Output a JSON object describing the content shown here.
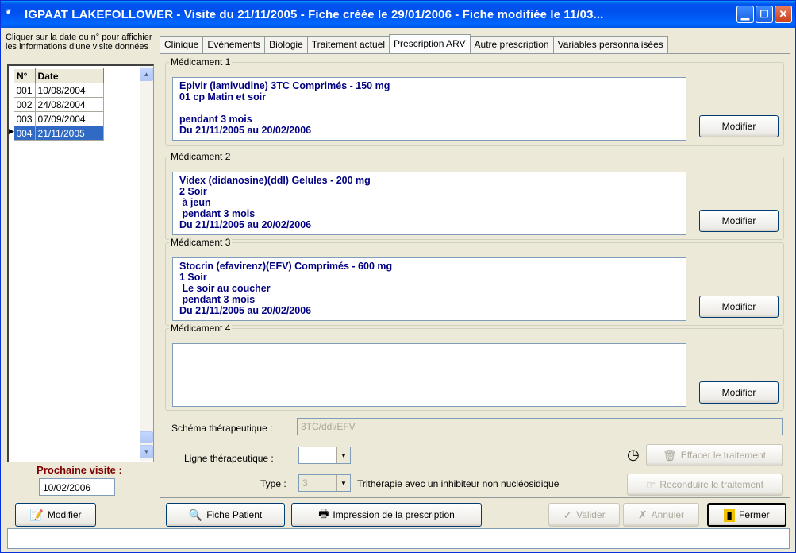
{
  "window": {
    "title": "IGPAAT LAKEFOLLOWER - Visite du 21/11/2005 - Fiche créée le 29/01/2006 - Fiche modifiée le 11/03...",
    "app_icon": "app-logo-icon",
    "controls": [
      "minimize",
      "maximize",
      "close"
    ]
  },
  "left": {
    "hint": "Cliquer sur la date ou n° pour affichier les informations d'une visite données",
    "columns": [
      "N°",
      "Date"
    ],
    "rows": [
      {
        "num": "001",
        "date": "10/08/2004"
      },
      {
        "num": "002",
        "date": "24/08/2004"
      },
      {
        "num": "003",
        "date": "07/09/2004"
      },
      {
        "num": "004",
        "date": "21/11/2005",
        "selected": true
      }
    ],
    "next_visit_label": "Prochaine visite :",
    "next_visit_value": "10/02/2006"
  },
  "tabs": [
    {
      "label": "Clinique"
    },
    {
      "label": "Evènements"
    },
    {
      "label": "Biologie"
    },
    {
      "label": "Traitement actuel"
    },
    {
      "label": "Prescription ARV",
      "active": true
    },
    {
      "label": "Autre prescription"
    },
    {
      "label": "Variables personnalisées"
    }
  ],
  "medications": [
    {
      "legend": "Médicament 1",
      "text": "Epivir (lamivudine) 3TC Comprimés - 150 mg\n01 cp Matin et soir\n\npendant 3 mois\nDu 21/11/2005 au 20/02/2006",
      "button": "Modifier"
    },
    {
      "legend": "Médicament 2",
      "text": "Videx (didanosine)(ddl) Gelules - 200 mg\n2 Soir\n à jeun\n pendant 3 mois\nDu 21/11/2005 au 20/02/2006",
      "button": "Modifier"
    },
    {
      "legend": "Médicament 3",
      "text": "Stocrin (efavirenz)(EFV) Comprimés - 600 mg\n1 Soir\n Le soir au coucher\n pendant 3 mois\nDu 21/11/2005 au 20/02/2006",
      "button": "Modifier"
    },
    {
      "legend": "Médicament 4",
      "text": "",
      "button": "Modifier"
    }
  ],
  "schema": {
    "label": "Schéma thérapeutique :",
    "value": "3TC/ddl/EFV"
  },
  "ligne": {
    "label": "Ligne thérapeutique :",
    "value": ""
  },
  "type": {
    "label": "Type :",
    "value": "3",
    "description": "Trithérapie avec un inhibiteur non nucléosidique"
  },
  "side_buttons": {
    "effacer": "Effacer le traitement",
    "reconduire": "Reconduire le traitement"
  },
  "bottom": {
    "modifier": "Modifier",
    "fiche_patient": "Fiche Patient",
    "impression": "Impression de la prescription",
    "valider": "Valider",
    "annuler": "Annuler",
    "fermer": "Fermer"
  },
  "status_text": ""
}
